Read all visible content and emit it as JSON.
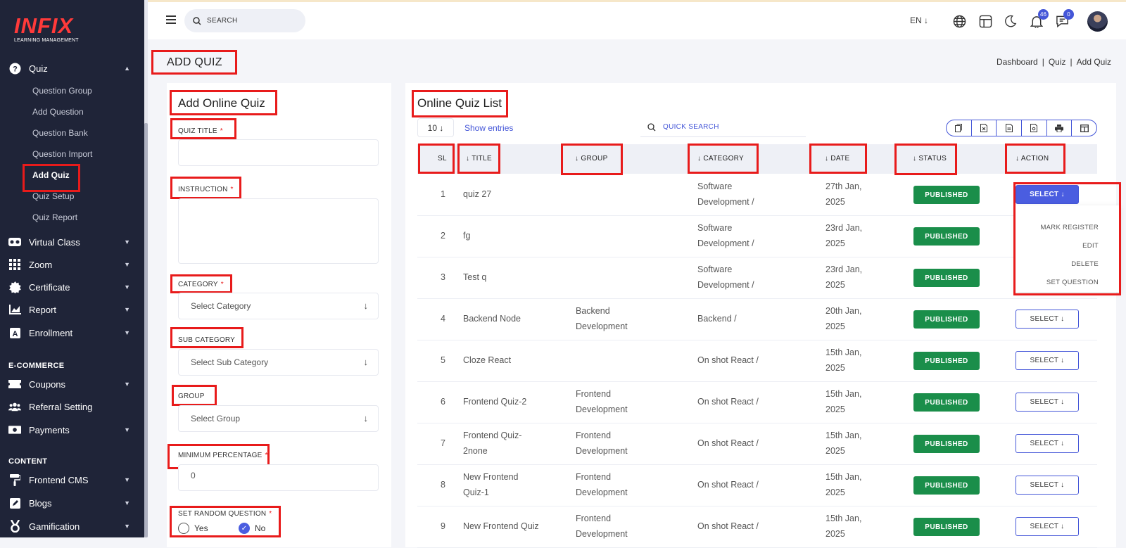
{
  "brand": {
    "logo_text": "INFIX",
    "logo_sub": "LEARNING MANAGEMENT"
  },
  "sidebar": {
    "quiz": {
      "label": "Quiz",
      "subs": [
        "Question Group",
        "Add Question",
        "Question Bank",
        "Question Import",
        "Add Quiz",
        "Quiz Setup",
        "Quiz Report"
      ],
      "active": "Add Quiz"
    },
    "items1": [
      {
        "label": "Virtual Class",
        "icon": "vr-icon"
      },
      {
        "label": "Zoom",
        "icon": "grid-icon"
      },
      {
        "label": "Certificate",
        "icon": "certificate-icon"
      },
      {
        "label": "Report",
        "icon": "chart-icon"
      },
      {
        "label": "Enrollment",
        "icon": "enrollment-icon"
      }
    ],
    "section_ecommerce": "E-COMMERCE",
    "items2": [
      {
        "label": "Coupons",
        "icon": "ticket-icon"
      },
      {
        "label": "Referral Setting",
        "icon": "users-icon"
      },
      {
        "label": "Payments",
        "icon": "money-icon"
      }
    ],
    "section_content": "CONTENT",
    "items3": [
      {
        "label": "Frontend CMS",
        "icon": "paint-roller-icon"
      },
      {
        "label": "Blogs",
        "icon": "pen-icon"
      },
      {
        "label": "Gamification",
        "icon": "medal-icon"
      }
    ]
  },
  "topbar": {
    "search_placeholder": "SEARCH",
    "lang": "EN ↓",
    "notif_count": "46",
    "msg_count": "0"
  },
  "page": {
    "title": "ADD QUIZ",
    "breadcrumb": [
      "Dashboard",
      "Quiz",
      "Add Quiz"
    ]
  },
  "form": {
    "title": "Add Online Quiz",
    "quiz_title_label": "QUIZ TITLE",
    "instruction_label": "INSTRUCTION",
    "category_label": "CATEGORY",
    "category_placeholder": "Select Category",
    "subcategory_label": "SUB CATEGORY",
    "subcategory_placeholder": "Select Sub Category",
    "group_label": "GROUP",
    "group_placeholder": "Select Group",
    "minpct_label": "MINIMUM PERCENTAGE",
    "minpct_value": "0",
    "random_label": "SET RANDOM QUESTION",
    "yes": "Yes",
    "no": "No",
    "required": "*"
  },
  "list": {
    "title": "Online Quiz List",
    "per_page": "10 ↓",
    "show_entries": "Show entries",
    "quick_search": "QUICK SEARCH",
    "headers": [
      "SL",
      "↓ TITLE",
      "↓ GROUP",
      "↓ CATEGORY",
      "↓ DATE",
      "↓ STATUS",
      "↓ ACTION"
    ],
    "rows": [
      {
        "sl": "1",
        "title1": "quiz 27",
        "title2": "",
        "group1": "",
        "group2": "",
        "cat1": "Software",
        "cat2": "Development /",
        "date1": "27th Jan,",
        "date2": "2025",
        "status": "PUBLISHED"
      },
      {
        "sl": "2",
        "title1": "fg",
        "title2": "",
        "group1": "",
        "group2": "",
        "cat1": "Software",
        "cat2": "Development /",
        "date1": "23rd Jan,",
        "date2": "2025",
        "status": "PUBLISHED"
      },
      {
        "sl": "3",
        "title1": "Test q",
        "title2": "",
        "group1": "",
        "group2": "",
        "cat1": "Software",
        "cat2": "Development /",
        "date1": "23rd Jan,",
        "date2": "2025",
        "status": "PUBLISHED"
      },
      {
        "sl": "4",
        "title1": "Backend Node",
        "title2": "",
        "group1": "Backend",
        "group2": "Development",
        "cat1": "Backend /",
        "cat2": "",
        "date1": "20th Jan,",
        "date2": "2025",
        "status": "PUBLISHED"
      },
      {
        "sl": "5",
        "title1": "Cloze React",
        "title2": "",
        "group1": "",
        "group2": "",
        "cat1": "On shot React /",
        "cat2": "",
        "date1": "15th Jan,",
        "date2": "2025",
        "status": "PUBLISHED"
      },
      {
        "sl": "6",
        "title1": "Frontend Quiz-2",
        "title2": "",
        "group1": "Frontend",
        "group2": "Development",
        "cat1": "On shot React /",
        "cat2": "",
        "date1": "15th Jan,",
        "date2": "2025",
        "status": "PUBLISHED"
      },
      {
        "sl": "7",
        "title1": "Frontend Quiz-",
        "title2": "2none",
        "group1": "Frontend",
        "group2": "Development",
        "cat1": "On shot React /",
        "cat2": "",
        "date1": "15th Jan,",
        "date2": "2025",
        "status": "PUBLISHED"
      },
      {
        "sl": "8",
        "title1": "New Frontend",
        "title2": "Quiz-1",
        "group1": "Frontend",
        "group2": "Development",
        "cat1": "On shot React /",
        "cat2": "",
        "date1": "15th Jan,",
        "date2": "2025",
        "status": "PUBLISHED"
      },
      {
        "sl": "9",
        "title1": "New Frontend Quiz",
        "title2": "",
        "group1": "Frontend",
        "group2": "Development",
        "cat1": "On shot React /",
        "cat2": "",
        "date1": "15th Jan,",
        "date2": "2025",
        "status": "PUBLISHED"
      }
    ],
    "select_label": "SELECT ↓",
    "dropdown": [
      "MARK REGISTER",
      "EDIT",
      "DELETE",
      "SET QUESTION"
    ]
  },
  "colors": {
    "sidebar": "#1f2438",
    "accent": "#4456d8",
    "published": "#1a8e4a",
    "highlight": "#e81b1b"
  }
}
